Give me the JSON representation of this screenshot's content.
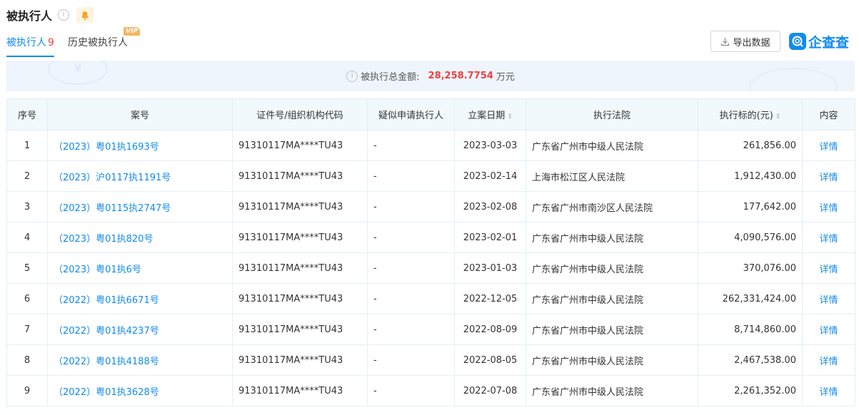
{
  "header": {
    "title": "被执行人"
  },
  "tabs": {
    "active_label": "被执行人",
    "active_count": "9",
    "history_label": "历史被执行人",
    "vip_badge": "VIP"
  },
  "toolbar": {
    "export_label": "导出数据"
  },
  "brand": {
    "name": "企查查",
    "color": "#128bed"
  },
  "summary": {
    "label": "被执行总金额:",
    "amount": "28,258.7754",
    "unit": "万元"
  },
  "table": {
    "columns": [
      "序号",
      "案号",
      "证件号/组织机构代码",
      "疑似申请执行人",
      "立案日期",
      "执行法院",
      "执行标的(元)",
      "内容"
    ],
    "rows": [
      {
        "no": "1",
        "case": "（2023）粤01执1693号",
        "id": "91310117MA****TU43",
        "applicant": "-",
        "date": "2023-03-03",
        "court": "广东省广州市中级人民法院",
        "amount": "261,856.00",
        "action": "详情"
      },
      {
        "no": "2",
        "case": "（2023）沪0117执1191号",
        "id": "91310117MA****TU43",
        "applicant": "-",
        "date": "2023-02-14",
        "court": "上海市松江区人民法院",
        "amount": "1,912,430.00",
        "action": "详情"
      },
      {
        "no": "3",
        "case": "（2023）粤0115执2747号",
        "id": "91310117MA****TU43",
        "applicant": "-",
        "date": "2023-02-08",
        "court": "广东省广州市南沙区人民法院",
        "amount": "177,642.00",
        "action": "详情"
      },
      {
        "no": "4",
        "case": "（2023）粤01执820号",
        "id": "91310117MA****TU43",
        "applicant": "-",
        "date": "2023-02-01",
        "court": "广东省广州市中级人民法院",
        "amount": "4,090,576.00",
        "action": "详情"
      },
      {
        "no": "5",
        "case": "（2023）粤01执6号",
        "id": "91310117MA****TU43",
        "applicant": "-",
        "date": "2023-01-03",
        "court": "广东省广州市中级人民法院",
        "amount": "370,076.00",
        "action": "详情"
      },
      {
        "no": "6",
        "case": "（2022）粤01执6671号",
        "id": "91310117MA****TU43",
        "applicant": "-",
        "date": "2022-12-05",
        "court": "广东省广州市中级人民法院",
        "amount": "262,331,424.00",
        "action": "详情"
      },
      {
        "no": "7",
        "case": "（2022）粤01执4237号",
        "id": "91310117MA****TU43",
        "applicant": "-",
        "date": "2022-08-09",
        "court": "广东省广州市中级人民法院",
        "amount": "8,714,860.00",
        "action": "详情"
      },
      {
        "no": "8",
        "case": "（2022）粤01执4188号",
        "id": "91310117MA****TU43",
        "applicant": "-",
        "date": "2022-08-05",
        "court": "广东省广州市中级人民法院",
        "amount": "2,467,538.00",
        "action": "详情"
      },
      {
        "no": "9",
        "case": "（2022）粤01执3628号",
        "id": "91310117MA****TU43",
        "applicant": "-",
        "date": "2022-07-08",
        "court": "广东省广州市中级人民法院",
        "amount": "2,261,352.00",
        "action": "详情"
      }
    ]
  }
}
